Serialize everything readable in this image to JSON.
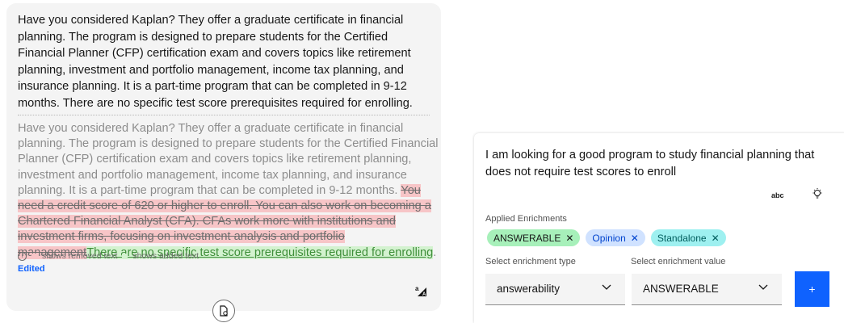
{
  "answer": {
    "text": "Have you considered Kaplan? They offer a graduate certificate in financial planning. The program is designed to prepare students for the Certified Financial Planner (CFP) certification exam and covers topics like retirement planning, investment and portfolio management, income tax planning, and insurance planning. It is a part-time program that can be completed in 9-12 months. There are no specific test score prerequisites required for enrolling."
  },
  "diff": {
    "unchanged": "Have you considered Kaplan? They offer a graduate certificate in financial planning. The program is designed to prepare students for the Certified Financial Planner (CFP) certification exam and covers topics like retirement planning, investment and portfolio management, income tax planning, and insurance planning. It is a part-time program that can be completed in 9-12 months. ",
    "removed": "You need a credit score of 620 or higher to enroll. You can also work on becoming a Chartered Financial Analyst (CFA). CFAs work more with institutions and investment firms, focusing on investment analysis and portfolio management",
    "added": "There are no specific test score prerequisites required for enrolling",
    "end": "."
  },
  "legend": {
    "removed_label": "shows removed text",
    "added_label": "shows added text",
    "removed_color": "#f7c5c7",
    "added_color": "#d3f2cf"
  },
  "status": {
    "edited": "Edited"
  },
  "icons": {
    "translate": "translate-icon",
    "document": "document-icon",
    "spell_check": "spell-check-icon",
    "lightbulb": "lightbulb-icon"
  },
  "query": {
    "text": "I am looking for a good program to study financial planning that does not require test scores to enroll",
    "spell_check_label": "abc"
  },
  "enrichments": {
    "label": "Applied Enrichments",
    "tags": [
      {
        "label": "ANSWERABLE",
        "color": "#a7f0ba"
      },
      {
        "label": "Opinion",
        "color": "#d0e2ff"
      },
      {
        "label": "Standalone",
        "color": "#9ef0f0"
      }
    ]
  },
  "selects": {
    "type_label": "Select enrichment type",
    "type_value": "answerability",
    "value_label": "Select enrichment value",
    "value_value": "ANSWERABLE"
  },
  "add_button": {
    "label": "+",
    "color": "#0f62fe"
  }
}
